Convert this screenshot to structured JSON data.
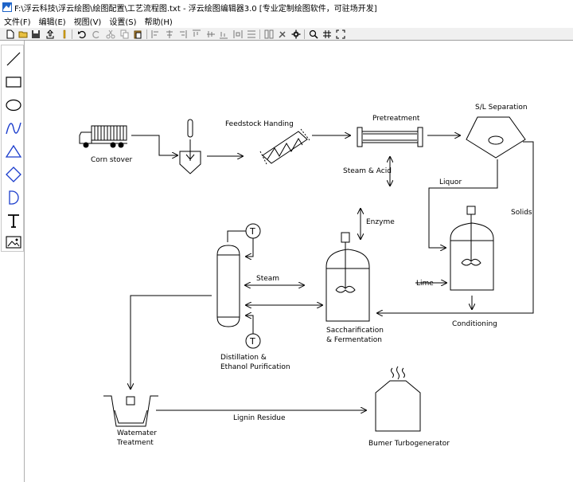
{
  "window": {
    "title": "F:\\浮云科技\\浮云绘图\\绘图配置\\工艺流程图.txt - 浮云绘图编辑器3.0 [专业定制绘图软件，可驻场开发]"
  },
  "menu": [
    "文件(F)",
    "编辑(E)",
    "视图(V)",
    "设置(S)",
    "帮助(H)"
  ],
  "toolbar": {
    "buttons": [
      "new-file-icon",
      "open-folder-icon",
      "save-icon",
      "export-icon",
      "pencil-icon",
      "undo-icon",
      "redo-icon",
      "cut-icon",
      "copy-icon",
      "paste-icon",
      "align-left-icon",
      "align-center-icon",
      "align-right-icon",
      "align-top-icon",
      "align-middle-icon",
      "align-bottom-icon",
      "distribute-h-icon",
      "distribute-v-icon",
      "same-size-icon",
      "tools-icon",
      "settings-gear-icon",
      "zoom-icon",
      "grid-icon",
      "fit-icon"
    ]
  },
  "tools": [
    "line-tool-icon",
    "rectangle-tool-icon",
    "ellipse-tool-icon",
    "curve-tool-icon",
    "triangle-tool-icon",
    "diamond-tool-icon",
    "half-circle-tool-icon",
    "text-tool-icon",
    "image-tool-icon"
  ],
  "diagram": {
    "corn_stover": "Corn stover",
    "feedstock": "Feedstock Handing",
    "pretreatment": "Pretreatment",
    "sl_separation": "S/L Separation",
    "steam_acid": "Steam & Acid",
    "liquor": "Liquor",
    "solids": "Solids",
    "enzyme": "Enzyme",
    "steam": "Steam",
    "lime": "Lime",
    "conditioning": "Conditioning",
    "sacch_1": "Saccharification",
    "sacch_2": "& Fermentation",
    "distill_1": "Distillation &",
    "distill_2": "Ethanol Purification",
    "waste_1": "Watemater",
    "waste_2": "Treatment",
    "lignin": "Lignin Residue",
    "burner": "Bumer Turbogenerator",
    "temp_symbol": "T"
  }
}
